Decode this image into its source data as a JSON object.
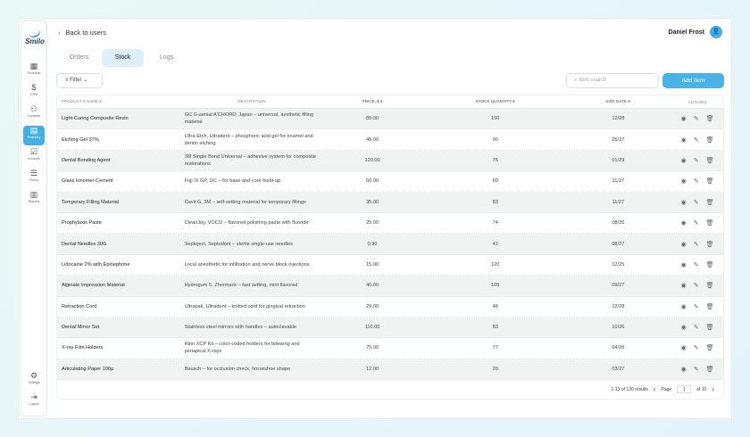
{
  "brand": "Smilo",
  "sidebar": {
    "items": [
      {
        "label": "Schedule",
        "icon": "calendar-icon"
      },
      {
        "label": "CRM",
        "icon": "dollar-icon"
      },
      {
        "label": "Contacts",
        "icon": "contacts-icon"
      },
      {
        "label": "Inventory",
        "icon": "inventory-icon",
        "active": true
      },
      {
        "label": "Invoices",
        "icon": "invoice-icon"
      },
      {
        "label": "Forms",
        "icon": "forms-icon"
      },
      {
        "label": "Reports",
        "icon": "reports-icon"
      }
    ],
    "bottom": [
      {
        "label": "Settings",
        "icon": "gear-icon"
      },
      {
        "label": "Logout",
        "icon": "logout-icon"
      }
    ]
  },
  "header": {
    "back": "Back to users",
    "user": "Daniel Frost"
  },
  "tabs": [
    "Orders",
    "Stock",
    "Logs"
  ],
  "toolbar": {
    "filter": "Filter",
    "search_placeholder": "Item search",
    "add": "Add item"
  },
  "table": {
    "headers": [
      "PRODUCT'S NAME",
      "DESCRIPTION",
      "PRICE, $",
      "STOCK QUANTITY",
      "EXP. DATE",
      "ACTIONS"
    ],
    "rows": [
      [
        "Light-Curing Composite Resin",
        "GC G-aenial A'CHORD, Japan – universal, aesthetic filling material",
        "89.00",
        "150",
        "12/28"
      ],
      [
        "Etching Gel 37%",
        "Ultra-Etch, Ultradent – phosphoric acid gel for enamel and dentin etching",
        "45.00",
        "90",
        "05/27"
      ],
      [
        "Dental Bonding Agent",
        "3M Single Bond Universal – adhesive system for composite restorations",
        "120.00",
        "75",
        "01/29"
      ],
      [
        "Glass Ionomer Cement",
        "Fuji IX GP, GC – for base and core build-up",
        "60.00",
        "60",
        "11/27"
      ],
      [
        "Temporary Filling Material",
        "Cavit G, 3M – self-setting material for temporary fillings",
        "35.00",
        "83",
        "11/27"
      ],
      [
        "Prophylaxis Paste",
        "CleanJoy, VOCO – flavored polishing paste with fluoride",
        "25.00",
        "74",
        "08/26"
      ],
      [
        "Dental Needles 30G",
        "Septoject, Septodont – sterile single-use needles",
        "0.90",
        "41",
        "08/27"
      ],
      [
        "Lidocaine 2% with Epinephrine",
        "Local anesthetic for infiltration and nerve block injections",
        "15.00",
        "120",
        "12/25"
      ],
      [
        "Alginate Impression Material",
        "Hydrogum 5, Zhermack – fast setting, mint flavored",
        "40.00",
        "105",
        "09/27"
      ],
      [
        "Retraction Cord",
        "Ultrapak, Ultradent – knitted cord for gingival retraction",
        "29.00",
        "48",
        "12/28"
      ],
      [
        "Dental Mirror Set",
        "Stainless steel mirrors with handles – autoclavable",
        "110.00",
        "83",
        "10/26"
      ],
      [
        "X-ray Film Holders",
        "Rinn XCP Kit – color-coded holders for bitewing and periapical X-rays",
        "75.00",
        "77",
        "04/26"
      ],
      [
        "Articulating Paper 100µ",
        "Bausch – for occlusion check, horseshoe shape",
        "12.00",
        "29",
        "03/27"
      ]
    ]
  },
  "pagination": {
    "summary": "1-13 of 130 results",
    "page_label": "Page",
    "page": "1",
    "of": "of 10"
  }
}
